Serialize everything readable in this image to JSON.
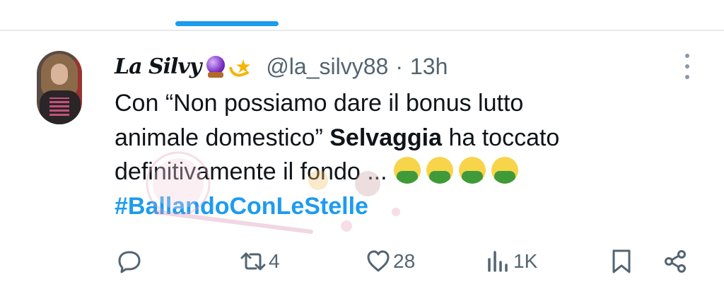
{
  "tweet": {
    "display_name": "La Silvy",
    "name_emojis": [
      "crystal-ball",
      "dizzy"
    ],
    "handle": "@la_silvy88",
    "separator": "·",
    "time": "13h",
    "text_line1": "Con “Non possiamo dare il bonus lutto",
    "text_line2_a": "animale domestico” ",
    "text_line2_b": "Selvaggia",
    "text_line2_c": " ha toccato",
    "text_line3": "definitivamente il fondo ... ",
    "text_line3_emojis": [
      "nauseated-face",
      "nauseated-face",
      "nauseated-face",
      "nauseated-face"
    ],
    "hashtag": "#BallandoConLeStelle"
  },
  "actions": {
    "reply_count": "",
    "retweet_count": "4",
    "like_count": "28",
    "views_count": "1K"
  },
  "colors": {
    "accent": "#1d9bf0",
    "secondary_text": "#536471",
    "primary_text": "#0f1419"
  }
}
